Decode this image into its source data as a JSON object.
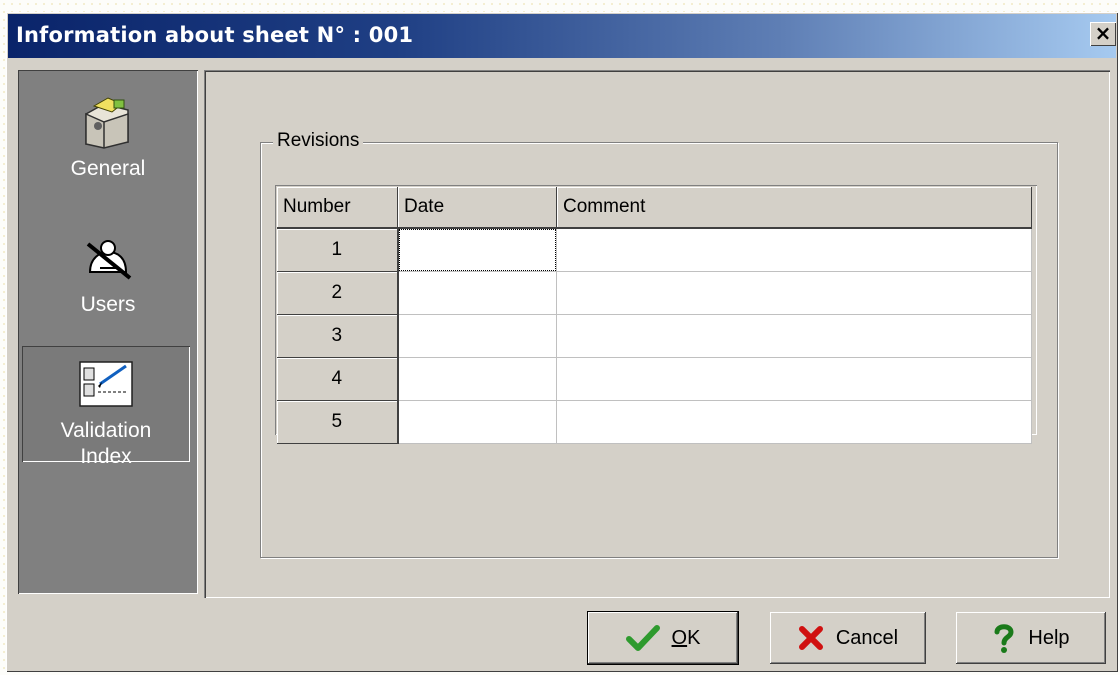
{
  "window": {
    "title": "Information about sheet N° : 001",
    "close_label": "×"
  },
  "sidebar": {
    "items": [
      {
        "label": "General",
        "icon": "folder-icon",
        "selected": false
      },
      {
        "label": "Users",
        "icon": "users-icon",
        "selected": false
      },
      {
        "label_line1": "Validation",
        "label_line2": "Index",
        "icon": "validation-index-icon",
        "selected": true
      }
    ]
  },
  "revisions": {
    "group_label": "Revisions",
    "columns": [
      "Number",
      "Date",
      "Comment"
    ],
    "rows": [
      {
        "number": "1",
        "date": "",
        "comment": ""
      },
      {
        "number": "2",
        "date": "",
        "comment": ""
      },
      {
        "number": "3",
        "date": "",
        "comment": ""
      },
      {
        "number": "4",
        "date": "",
        "comment": ""
      },
      {
        "number": "5",
        "date": "",
        "comment": ""
      }
    ]
  },
  "buttons": {
    "ok": {
      "mnemonic": "O",
      "rest": "K",
      "icon": "checkmark-icon"
    },
    "cancel": {
      "label": "Cancel",
      "icon": "red-x-icon"
    },
    "help": {
      "label": "Help",
      "icon": "question-mark-icon"
    }
  },
  "colors": {
    "titlebar_start": "#0a246a",
    "titlebar_end": "#a6caf0",
    "dialog_face": "#d4d0c8",
    "ok_check": "#2e9a2e",
    "cancel_x": "#d01010",
    "help_mark": "#1a7a1a"
  }
}
